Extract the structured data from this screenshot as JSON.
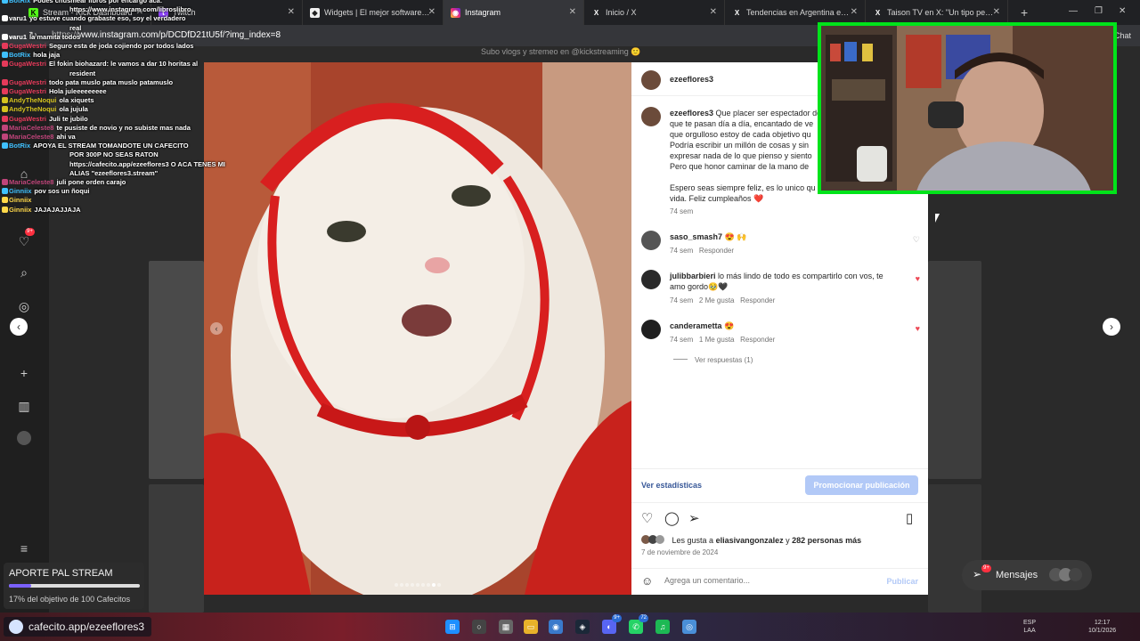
{
  "tabs": [
    {
      "label": "Stream - Kick Dashboard",
      "icon": "kick-icon"
    },
    {
      "label": "Twitch",
      "icon": "twitch-icon"
    },
    {
      "label": "Widgets | El mejor software para p",
      "icon": "widgets-icon"
    },
    {
      "label": "Instagram",
      "icon": "instagram-icon",
      "active": true
    },
    {
      "label": "Inicio / X",
      "icon": "x-icon"
    },
    {
      "label": "Tendencias en Argentina en X: \"F",
      "icon": "x-icon"
    },
    {
      "label": "Taison TV en X: \"Un tipo pesco 10",
      "icon": "x-icon"
    }
  ],
  "address": {
    "url_prefix": "https://",
    "url_main": "www.instagram.com/p/DCDfD21tU5f/?img_index=8"
  },
  "chat_panel_label": "Chat",
  "chat": [
    {
      "nick": "BotRix",
      "msg": "Podes chusmear libros por encargo aca:",
      "color": "#3fc1ff"
    },
    {
      "nick": "",
      "msg": "https://www.instagram.com/libroslibro",
      "color": "#3fc1ff"
    },
    {
      "nick": "varu1",
      "msg": "yo estuve cuando grabaste eso, soy el verdadero",
      "color": "#ffffff"
    },
    {
      "nick": "",
      "msg": "real",
      "color": "#ffffff"
    },
    {
      "nick": "varu1",
      "msg": "la mamita todos",
      "color": "#ffffff"
    },
    {
      "nick": "GugaWestri",
      "msg": "Seguro esta de joda cojiendo por todos lados",
      "color": "#e53a5a"
    },
    {
      "nick": "BotRix",
      "msg": "hola jaja",
      "color": "#3fc1ff"
    },
    {
      "nick": "GugaWestri",
      "msg": "El fokin biohazard: le vamos a dar 10 horitas al",
      "color": "#e53a5a"
    },
    {
      "nick": "",
      "msg": "resident",
      "color": "#e53a5a"
    },
    {
      "nick": "GugaWestri",
      "msg": "todo pata muslo pata muslo patamuslo",
      "color": "#e53a5a"
    },
    {
      "nick": "GugaWestri",
      "msg": "Hola juleeeeeeeee",
      "color": "#e53a5a"
    },
    {
      "nick": "AndyTheNoqui",
      "msg": "ola xiquets",
      "color": "#d4c21f"
    },
    {
      "nick": "AndyTheNoqui",
      "msg": "ola jujula",
      "color": "#d4c21f"
    },
    {
      "nick": "GugaWestri",
      "msg": "Juli te jubilo",
      "color": "#e53a5a"
    },
    {
      "nick": "MariaCeleste8",
      "msg": "te pusiste de novio y no subiste mas nada",
      "color": "#c0447a"
    },
    {
      "nick": "MariaCeleste8",
      "msg": "ahi va",
      "color": "#c0447a"
    },
    {
      "nick": "BotRix",
      "msg": "APOYA EL STREAM TOMANDOTE UN CAFECITO",
      "color": "#3fc1ff"
    },
    {
      "nick": "",
      "msg": "POR 300P NO SEAS RATON",
      "color": "#3fc1ff"
    },
    {
      "nick": "",
      "msg": "https://cafecito.app/ezeeflores3 O ACA TENES MI",
      "color": "#3fc1ff"
    },
    {
      "nick": "",
      "msg": "ALIAS \"ezeeflores3.stream\"",
      "color": "#3fc1ff"
    },
    {
      "nick": "MariaCeleste8",
      "msg": "juli pone orden carajo",
      "color": "#c0447a"
    },
    {
      "nick": "Ginniix",
      "msg": "pov sos un ñoqui",
      "color": "#3fc1ff"
    },
    {
      "nick": "Ginniix",
      "msg": "",
      "color": "#ffd84a"
    },
    {
      "nick": "Ginniix",
      "msg": "JAJAJAJJAJA",
      "color": "#ffd84a"
    }
  ],
  "bg_profile_text": "Subo vlogs y stremeo en @kickstreaming 🙂",
  "post": {
    "author": "ezeeflores3",
    "caption_lines": [
      "Que placer ser espectador de",
      "que te pasan día a día, encantado de ve",
      "que orgulloso estoy de cada objetivo qu",
      "Podría escribir un millón de cosas y sin",
      "expresar nada de lo que pienso y siento",
      "Pero que honor caminar de la mano de"
    ],
    "caption_end": [
      "Espero seas siempre feliz, es lo unico qu",
      "vida. Feliz cumpleaños ❤️"
    ],
    "caption_time": "74 sem",
    "comments": [
      {
        "user": "saso_smash7",
        "text": "😍 🙌",
        "text2": "",
        "time": "74 sem",
        "likes": "",
        "reply": "Responder",
        "liked": false
      },
      {
        "user": "julibbarbieri",
        "text": "lo más lindo de todo es compartirlo con vos, te",
        "text2": "amo gordo🥹🖤",
        "time": "74 sem",
        "likes": "2 Me gusta",
        "reply": "Responder",
        "liked": true
      },
      {
        "user": "canderametta",
        "text": "😍",
        "text2": "",
        "time": "74 sem",
        "likes": "1 Me gusta",
        "reply": "Responder",
        "liked": true
      }
    ],
    "view_replies": "Ver respuestas (1)",
    "stats_link": "Ver estadísticas",
    "promote_button": "Promocionar publicación",
    "liked_by_prefix": "Les gusta a",
    "liked_by_user": "eliasivangonzalez",
    "liked_by_and": "y",
    "liked_by_rest": "282 personas más",
    "date": "7 de noviembre de 2024",
    "comment_placeholder": "Agrega un comentario...",
    "publish": "Publicar",
    "carousel_index": 8,
    "carousel_total": 9
  },
  "notifications_badge": "9+",
  "messages": {
    "label": "Mensajes",
    "badge": "9+"
  },
  "donation": {
    "title": "APORTE PAL STREAM",
    "progress_text": "17% del objetivo de 100 Cafecitos",
    "progress_fraction": 0.17
  },
  "taskbar": {
    "cafe_url": "cafecito.app/ezeeflores3",
    "icons": [
      {
        "name": "windows-start-icon",
        "badge": ""
      },
      {
        "name": "search-icon",
        "badge": ""
      },
      {
        "name": "file-explorer-icon",
        "badge": ""
      },
      {
        "name": "folder-icon",
        "badge": ""
      },
      {
        "name": "browser-icon",
        "badge": ""
      },
      {
        "name": "steam-icon",
        "badge": ""
      },
      {
        "name": "discord-icon",
        "badge": "9+"
      },
      {
        "name": "whatsapp-icon",
        "badge": "72"
      },
      {
        "name": "spotify-icon",
        "badge": ""
      },
      {
        "name": "app-icon",
        "badge": ""
      }
    ],
    "lang_top": "ESP",
    "lang_bottom": "LAA",
    "time": "12:17",
    "date": "10/1/2026"
  }
}
